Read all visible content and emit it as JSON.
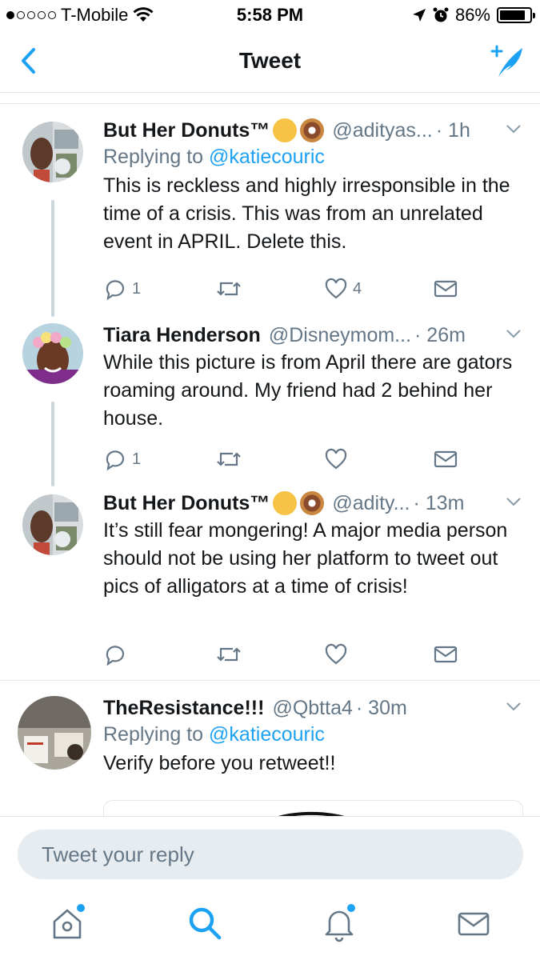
{
  "status_bar": {
    "carrier": "T-Mobile",
    "time": "5:58 PM",
    "battery": "86%",
    "battery_level": 0.86
  },
  "nav": {
    "title": "Tweet"
  },
  "tweets": [
    {
      "name": "But Her Donuts™",
      "handle": "@adityas...",
      "time": "· 1h",
      "replying_prefix": "Replying to",
      "replying_to": "@katiecouric",
      "text": "This is reckless and highly irresponsible in the time of a crisis. This was from an unrelated event in APRIL. Delete this.",
      "reply_count": "1",
      "like_count": "4"
    },
    {
      "name": "Tiara Henderson",
      "handle": "@Disneymom...",
      "time": "· 26m",
      "text": "While this picture is from April there are gators roaming around. My friend had 2 behind her house.",
      "reply_count": "1"
    },
    {
      "name": "But Her Donuts™",
      "handle": "@adity...",
      "time": "· 13m",
      "text": "It’s still fear mongering! A major media person should not be using her platform to tweet out pics of alligators at a time of crisis!"
    },
    {
      "name": "TheResistance!!!",
      "handle": "@Qbtta4",
      "time": "· 30m",
      "replying_prefix": "Replying to",
      "replying_to": "@katiecouric",
      "text": "Verify before you retweet!!"
    }
  ],
  "reply_bar": {
    "placeholder": "Tweet your reply"
  },
  "colors": {
    "accent": "#1da1f2",
    "secondary_text": "#657786",
    "divider": "#e1e8ed"
  },
  "icons": [
    "back-chevron-icon",
    "compose-icon",
    "reply-icon",
    "retweet-icon",
    "like-icon",
    "dm-icon",
    "home-icon",
    "search-icon",
    "notifications-icon",
    "messages-icon"
  ]
}
